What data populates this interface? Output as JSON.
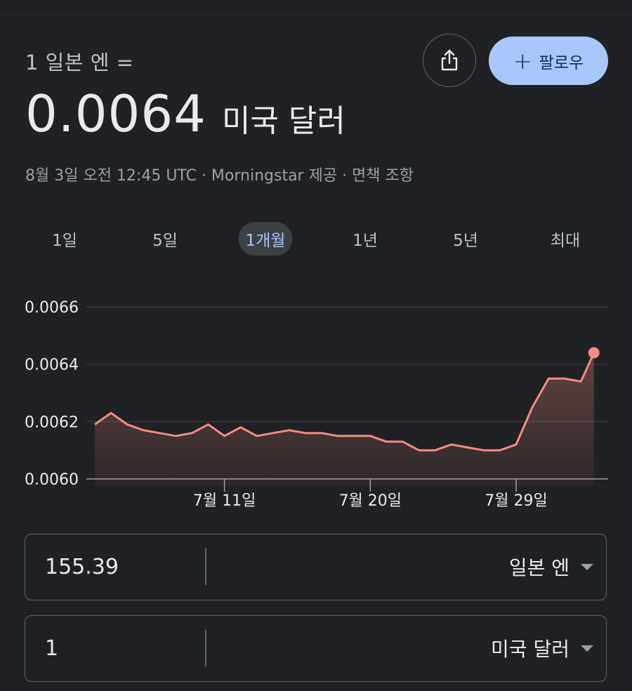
{
  "header": {
    "subtitle": "1 일본 엔 =",
    "rate_value": "0.0064",
    "rate_unit": "미국 달러",
    "meta": "8월 3일 오전 12:45 UTC · Morningstar 제공 · 면책 조항",
    "share_icon": "share-icon",
    "follow_plus": "+",
    "follow_label": "팔로우"
  },
  "tabs": [
    {
      "label": "1일",
      "active": false
    },
    {
      "label": "5일",
      "active": false
    },
    {
      "label": "1개월",
      "active": true
    },
    {
      "label": "1년",
      "active": false
    },
    {
      "label": "5년",
      "active": false
    },
    {
      "label": "최대",
      "active": false
    }
  ],
  "colors": {
    "background": "#202124",
    "line": "#f28b82",
    "accent": "#a8c7fa"
  },
  "chart_data": {
    "type": "area",
    "ylim": [
      0.006,
      0.0066
    ],
    "yticks": [
      {
        "value": 0.0066,
        "label": "0.0066"
      },
      {
        "value": 0.0064,
        "label": "0.0064"
      },
      {
        "value": 0.0062,
        "label": "0.0062"
      },
      {
        "value": 0.006,
        "label": "0.0060"
      }
    ],
    "xticks": [
      {
        "value": 8,
        "label": "7월 11일"
      },
      {
        "value": 17,
        "label": "7월 20일"
      },
      {
        "value": 26,
        "label": "7월 29일"
      }
    ],
    "xlim": [
      0.5,
      31.7
    ],
    "points": [
      [
        0.5,
        0.00619
      ],
      [
        1.5,
        0.00623
      ],
      [
        2.5,
        0.00619
      ],
      [
        3.5,
        0.00617
      ],
      [
        4.5,
        0.00616
      ],
      [
        5.5,
        0.00615
      ],
      [
        6.5,
        0.00616
      ],
      [
        7.5,
        0.00619
      ],
      [
        8.5,
        0.00615
      ],
      [
        9.5,
        0.00618
      ],
      [
        10.5,
        0.00615
      ],
      [
        11.5,
        0.00616
      ],
      [
        12.5,
        0.00617
      ],
      [
        13.5,
        0.00616
      ],
      [
        14.5,
        0.00616
      ],
      [
        15.5,
        0.00615
      ],
      [
        16.5,
        0.00615
      ],
      [
        17.5,
        0.00615
      ],
      [
        18.5,
        0.00613
      ],
      [
        19.5,
        0.00613
      ],
      [
        20.5,
        0.0061
      ],
      [
        21.5,
        0.0061
      ],
      [
        22.5,
        0.00612
      ],
      [
        23.5,
        0.00611
      ],
      [
        24.5,
        0.0061
      ],
      [
        25.5,
        0.0061
      ],
      [
        26.5,
        0.00612
      ],
      [
        27.5,
        0.00625
      ],
      [
        28.5,
        0.00635
      ],
      [
        29.5,
        0.00635
      ],
      [
        30.5,
        0.00634
      ],
      [
        31.3,
        0.00644
      ]
    ]
  },
  "converter": [
    {
      "value": "155.39",
      "currency": "일본 엔"
    },
    {
      "value": "1",
      "currency": "미국 달러"
    }
  ]
}
